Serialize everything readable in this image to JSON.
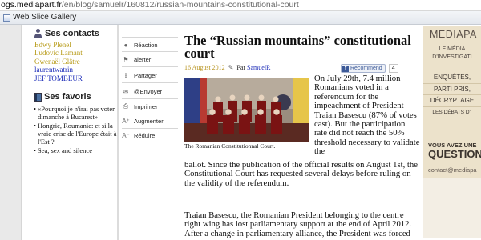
{
  "browser": {
    "url_prefix": "ogs.mediapart.fr",
    "url_path": "/en/blog/samuelr/160812/russian-mountains-constitutional-court",
    "bookmark_label": "Web Slice Gallery"
  },
  "sidebar": {
    "contacts_title": "Ses contacts",
    "contacts": [
      "Edwy Plenel",
      "Ludovic Lamant",
      "Gwenaël Glâtre",
      "laurentwatrin",
      "JEF TOMBEUR"
    ],
    "favorites_title": "Ses favoris",
    "favorites": [
      "«Pourquoi je n'irai pas voter dimanche à Bucarest»",
      "Hongrie, Roumanie: et si la vraie crise de l'Europe était à l'Est ?",
      "Sea, sex and silence"
    ]
  },
  "actions": [
    "Réaction",
    "alerter",
    "Partager",
    "@Envoyer",
    "Imprimer",
    "Augmenter",
    "Réduire"
  ],
  "article": {
    "title": "The “Russian mountains” constitutional court",
    "date": "16 August 2012",
    "by": "Par",
    "author": "SamuelR",
    "recommend_label": "Recommend",
    "recommend_count": "4",
    "caption": "The Romanian Constitutionnal Court.",
    "para1_side": "On July 29th, 7.4 million Romanians voted in a referendum for the impeachment of President Traian Basescu (87% of votes cast). But the participation rate did not reach the 50% threshold necessary to validate the",
    "para1_full": "ballot. Since the publication of the official results on August 1st, the Constitutional Court has requested several delays before ruling on the validity of the referendum.",
    "para2": "Traian Basescu, the Romanian President belonging to the centre right wing has lost parliamentary support at the end of April 2012. After a change in parliamentary alliance, the President was forced"
  },
  "promo": {
    "brand": "MEDIAPA",
    "line1": "LE MÉDIA",
    "line2": "D'INVESTIGATI",
    "items": [
      "ENQUÊTES,",
      "PARTI PRIS,",
      "DÉCRYPTAGE",
      "LES DÉBATS D'I"
    ],
    "q1": "VOUS AVEZ UNE",
    "q2": "QUESTION",
    "contact": "contact@mediapa"
  }
}
